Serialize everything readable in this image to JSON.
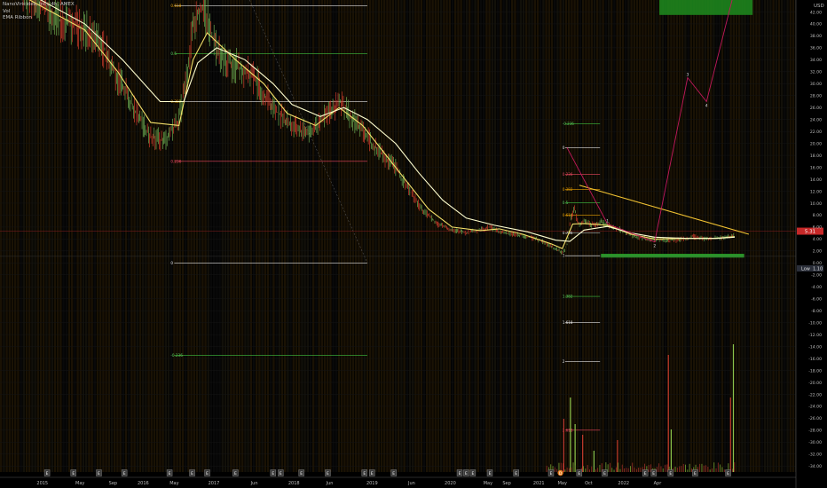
{
  "header": {
    "symbol_line": "NanoViricides, Inc., 4h, AMEX",
    "indicator_vol": "Vol",
    "indicator_ema": "EMA Ribbon"
  },
  "price_axis": {
    "currency": "USD",
    "current_price_label": "5.31",
    "low_tag_label": "Low",
    "low_tag_value": "1.10"
  },
  "chart_data": {
    "type": "line",
    "title": "NanoViricides, Inc., 4h, AMEX",
    "y_ticks": [
      "42.00",
      "40.00",
      "38.00",
      "36.00",
      "34.00",
      "32.00",
      "30.00",
      "28.00",
      "26.00",
      "24.00",
      "22.00",
      "20.00",
      "18.00",
      "16.00",
      "14.00",
      "12.00",
      "10.00",
      "8.00",
      "6.00",
      "4.00",
      "2.00",
      "0.00",
      "-2.00",
      "-4.00",
      "-6.00",
      "-8.00",
      "-10.00",
      "-12.00",
      "-14.00",
      "-16.00",
      "-18.00",
      "-20.00",
      "-22.00",
      "-24.00",
      "-26.00",
      "-28.00",
      "-30.00",
      "-32.00",
      "-34.00"
    ],
    "y_range": [
      -35,
      44
    ],
    "x_labels": [
      "2015",
      "May",
      "Sep",
      "2016",
      "May",
      "2017",
      "Jun",
      "2018",
      "Jun",
      "2019",
      "Jun",
      "2020",
      "May",
      "Sep",
      "2021",
      "May",
      "Oct",
      "2022",
      "Apr"
    ],
    "price_series": {
      "name": "Price",
      "points": [
        [
          2014.2,
          47.0
        ],
        [
          2014.6,
          41.0
        ],
        [
          2014.9,
          39.0
        ],
        [
          2015.1,
          36.0
        ],
        [
          2015.25,
          31.0
        ],
        [
          2015.45,
          25.0
        ],
        [
          2015.6,
          21.0
        ],
        [
          2015.75,
          20.5
        ],
        [
          2015.9,
          24.0
        ],
        [
          2015.98,
          31.0
        ],
        [
          2016.05,
          40.0
        ],
        [
          2016.15,
          43.0
        ],
        [
          2016.25,
          38.0
        ],
        [
          2016.35,
          34.0
        ],
        [
          2016.5,
          33.0
        ],
        [
          2016.7,
          31.0
        ],
        [
          2016.9,
          26.0
        ],
        [
          2017.05,
          23.5
        ],
        [
          2017.2,
          22.0
        ],
        [
          2017.35,
          22.5
        ],
        [
          2017.5,
          25.5
        ],
        [
          2017.6,
          27.0
        ],
        [
          2017.8,
          23.0
        ],
        [
          2018.0,
          19.0
        ],
        [
          2018.2,
          16.0
        ],
        [
          2018.35,
          12.0
        ],
        [
          2018.5,
          8.5
        ],
        [
          2018.65,
          6.5
        ],
        [
          2018.8,
          5.5
        ],
        [
          2018.95,
          5.0
        ],
        [
          2019.1,
          5.5
        ],
        [
          2019.2,
          6.0
        ],
        [
          2019.35,
          5.0
        ],
        [
          2019.55,
          4.6
        ],
        [
          2019.75,
          3.7
        ],
        [
          2019.9,
          2.4
        ],
        [
          2019.97,
          1.6
        ],
        [
          2020.02,
          3.0
        ],
        [
          2020.06,
          7.5
        ],
        [
          2020.1,
          9.0
        ],
        [
          2020.14,
          6.5
        ],
        [
          2020.2,
          7.0
        ],
        [
          2020.28,
          6.3
        ],
        [
          2020.38,
          6.8
        ],
        [
          2020.5,
          6.0
        ],
        [
          2020.6,
          5.5
        ],
        [
          2020.75,
          4.3
        ],
        [
          2020.9,
          4.0
        ],
        [
          2021.0,
          3.8
        ],
        [
          2021.2,
          3.8
        ],
        [
          2021.35,
          4.4
        ],
        [
          2021.5,
          4.0
        ],
        [
          2021.65,
          4.2
        ],
        [
          2021.8,
          4.6
        ]
      ]
    },
    "ema_series": [
      {
        "name": "EMA fast",
        "color": "#f4e06a",
        "points": [
          [
            2014.2,
            45.0
          ],
          [
            2014.9,
            39.0
          ],
          [
            2015.25,
            32.0
          ],
          [
            2015.6,
            23.5
          ],
          [
            2015.9,
            23.0
          ],
          [
            2016.05,
            34.0
          ],
          [
            2016.2,
            38.5
          ],
          [
            2016.5,
            34.0
          ],
          [
            2016.8,
            30.0
          ],
          [
            2017.05,
            25.0
          ],
          [
            2017.35,
            23.0
          ],
          [
            2017.6,
            26.0
          ],
          [
            2017.85,
            23.0
          ],
          [
            2018.1,
            18.0
          ],
          [
            2018.35,
            13.0
          ],
          [
            2018.55,
            9.0
          ],
          [
            2018.8,
            6.0
          ],
          [
            2019.1,
            5.4
          ],
          [
            2019.3,
            5.7
          ],
          [
            2019.55,
            4.8
          ],
          [
            2019.85,
            3.2
          ],
          [
            2019.97,
            2.4
          ],
          [
            2020.08,
            6.5
          ],
          [
            2020.2,
            6.6
          ],
          [
            2020.45,
            6.3
          ],
          [
            2020.7,
            4.8
          ],
          [
            2020.95,
            4.0
          ],
          [
            2021.3,
            4.1
          ],
          [
            2021.6,
            4.1
          ],
          [
            2021.8,
            4.4
          ]
        ]
      },
      {
        "name": "EMA slow",
        "color": "#ffffd0",
        "points": [
          [
            2014.2,
            46.0
          ],
          [
            2014.9,
            40.0
          ],
          [
            2015.3,
            34.0
          ],
          [
            2015.7,
            27.0
          ],
          [
            2015.95,
            27.0
          ],
          [
            2016.1,
            33.5
          ],
          [
            2016.3,
            36.0
          ],
          [
            2016.6,
            34.0
          ],
          [
            2016.9,
            30.0
          ],
          [
            2017.1,
            26.5
          ],
          [
            2017.4,
            24.5
          ],
          [
            2017.65,
            26.0
          ],
          [
            2017.9,
            24.0
          ],
          [
            2018.2,
            20.0
          ],
          [
            2018.45,
            15.0
          ],
          [
            2018.7,
            10.5
          ],
          [
            2018.95,
            7.5
          ],
          [
            2019.25,
            6.3
          ],
          [
            2019.6,
            5.2
          ],
          [
            2019.9,
            3.8
          ],
          [
            2020.05,
            3.6
          ],
          [
            2020.2,
            5.5
          ],
          [
            2020.45,
            6.1
          ],
          [
            2020.7,
            5.0
          ],
          [
            2020.95,
            4.3
          ],
          [
            2021.3,
            4.1
          ],
          [
            2021.6,
            4.1
          ],
          [
            2021.8,
            4.3
          ]
        ]
      }
    ],
    "fib_levels_left": [
      {
        "label": "0.618",
        "value": 43.0,
        "color": "#e8a000",
        "line": "#e0e0e0"
      },
      {
        "label": "0.5",
        "value": 35.0,
        "color": "#5dcf5d",
        "line": "#3fbf3f"
      },
      {
        "label": "0.382",
        "value": 27.0,
        "color": "#e8a000",
        "line": "#e0e0e0"
      },
      {
        "label": "0.236",
        "value": 17.0,
        "color": "#e8475f",
        "line": "#e8475f"
      },
      {
        "label": "0",
        "value": 0.0,
        "color": "#e0e0e0",
        "line": "#e0e0e0"
      },
      {
        "label": "-0.236",
        "value": -15.5,
        "color": "#5dcf5d",
        "line": "#3fbf3f"
      }
    ],
    "fib_levels_right": [
      {
        "label": "-0.236",
        "value": 23.3,
        "color": "#5dcf5d",
        "line": "#3fbf3f"
      },
      {
        "label": "0",
        "value": 19.3,
        "color": "#e0e0e0",
        "line": "#e0e0e0"
      },
      {
        "label": "0.236",
        "value": 14.8,
        "color": "#e8475f",
        "line": "#e8475f"
      },
      {
        "label": "0.382",
        "value": 12.3,
        "color": "#e8a000",
        "line": "#e8a000"
      },
      {
        "label": "0.5",
        "value": 10.1,
        "color": "#5dcf5d",
        "line": "#3fbf3f"
      },
      {
        "label": "0.618",
        "value": 8.0,
        "color": "#e8a000",
        "line": "#e8a000"
      },
      {
        "label": "0.786",
        "value": 5.0,
        "color": "#e0e0e0",
        "line": "#e0e0e0"
      },
      {
        "label": "1",
        "value": 1.2,
        "color": "#e0e0e0",
        "line": "#e0e0e0"
      },
      {
        "label": "1.382",
        "value": -5.6,
        "color": "#5dcf5d",
        "line": "#3fbf3f"
      },
      {
        "label": "1.618",
        "value": -10.0,
        "color": "#e0e0e0",
        "line": "#e0e0e0"
      },
      {
        "label": "2",
        "value": -16.5,
        "color": "#e0e0e0",
        "line": "#e0e0e0"
      },
      {
        "label": "2.618",
        "value": -28.0,
        "color": "#e8475f",
        "line": "#e8475f"
      }
    ],
    "trendline": {
      "from": [
        2020.15,
        13.0
      ],
      "to": [
        2021.95,
        4.8
      ],
      "color": "#f1c232"
    },
    "projection_path": {
      "color": "#c2185b",
      "points": [
        [
          2020.02,
          19.3
        ],
        [
          2020.45,
          6.5
        ],
        [
          2020.95,
          3.5
        ],
        [
          2021.3,
          31.0
        ],
        [
          2021.5,
          27.0
        ],
        [
          2021.78,
          44.5
        ]
      ],
      "point_labels": [
        "1",
        "2",
        "3",
        "4",
        "5"
      ]
    },
    "target_zone": {
      "x_from": 2021.0,
      "x_to": 2021.99,
      "y_from": 41.5,
      "y_to": 44.5,
      "color": "#1e8c1e"
    },
    "support_zone": {
      "x_from": 2020.38,
      "x_to": 2021.9,
      "y_from": 0.9,
      "y_to": 1.5,
      "color": "#2ba52b"
    },
    "volume_spikes": [
      {
        "x": 2019.98,
        "value": 10,
        "color": "#c0392b"
      },
      {
        "x": 2020.05,
        "value": 14,
        "color": "#8bc34a"
      },
      {
        "x": 2020.1,
        "value": 9,
        "color": "#8bc34a"
      },
      {
        "x": 2020.18,
        "value": 7,
        "color": "#c0392b"
      },
      {
        "x": 2020.3,
        "value": 4,
        "color": "#8bc34a"
      },
      {
        "x": 2020.55,
        "value": 6,
        "color": "#c0392b"
      },
      {
        "x": 2021.09,
        "value": 22,
        "color": "#c0392b"
      },
      {
        "x": 2021.12,
        "value": 8,
        "color": "#8bc34a"
      },
      {
        "x": 2021.78,
        "value": 24,
        "color": "#8bc34a"
      },
      {
        "x": 2021.75,
        "value": 14,
        "color": "#c0392b"
      }
    ],
    "event_markers": [
      {
        "x": 2014.5,
        "label": "E"
      },
      {
        "x": 2014.78,
        "label": "E"
      },
      {
        "x": 2015.05,
        "label": "E"
      },
      {
        "x": 2015.32,
        "label": "E"
      },
      {
        "x": 2015.8,
        "label": "E"
      },
      {
        "x": 2016.04,
        "label": "E"
      },
      {
        "x": 2016.2,
        "label": "E"
      },
      {
        "x": 2016.5,
        "label": "E"
      },
      {
        "x": 2016.9,
        "label": "E"
      },
      {
        "x": 2016.98,
        "label": "E"
      },
      {
        "x": 2017.2,
        "label": "E"
      },
      {
        "x": 2017.48,
        "label": "E"
      },
      {
        "x": 2017.87,
        "label": "E"
      },
      {
        "x": 2017.95,
        "label": "E"
      },
      {
        "x": 2018.18,
        "label": "E"
      },
      {
        "x": 2018.88,
        "label": "E"
      },
      {
        "x": 2018.95,
        "label": "E"
      },
      {
        "x": 2019.02,
        "label": "E"
      },
      {
        "x": 2019.2,
        "label": "E"
      },
      {
        "x": 2019.48,
        "label": "E"
      },
      {
        "x": 2019.85,
        "label": "E"
      },
      {
        "x": 2019.95,
        "label": "D"
      },
      {
        "x": 2020.15,
        "label": "E"
      },
      {
        "x": 2020.42,
        "label": "E"
      },
      {
        "x": 2020.85,
        "label": "E"
      },
      {
        "x": 2020.94,
        "label": "E"
      },
      {
        "x": 2021.12,
        "label": "E"
      },
      {
        "x": 2021.38,
        "label": "E"
      },
      {
        "x": 2021.73,
        "label": "E"
      }
    ]
  }
}
